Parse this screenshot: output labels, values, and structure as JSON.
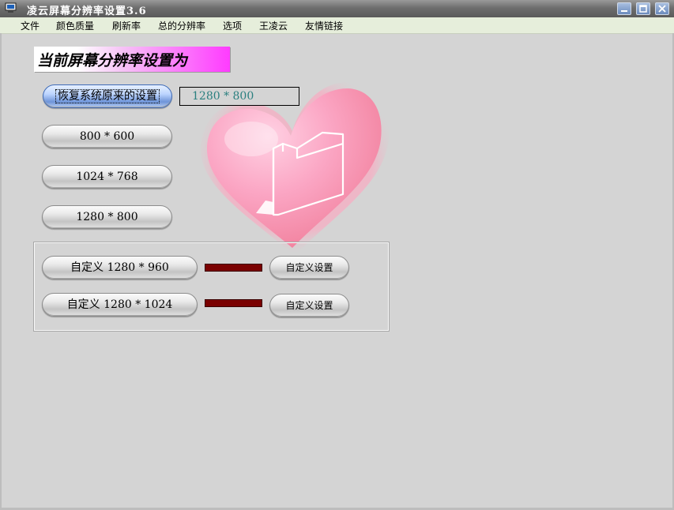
{
  "window": {
    "title": "凌云屏幕分辨率设置3.6"
  },
  "menu": [
    "文件",
    "颜色质量",
    "刷新率",
    "总的分辨率",
    "选项",
    "王凌云",
    "友情链接"
  ],
  "banner": "当前屏幕分辨率设置为",
  "current_resolution": "1280 * 800",
  "buttons": {
    "restore": "恢复系统原来的设置",
    "r800": "800 * 600",
    "r1024": "1024 * 768",
    "r1280": "1280 * 800",
    "custom1": "自定义 1280 * 960",
    "custom2": "自定义 1280 * 1024",
    "custom_set1": "自定义设置",
    "custom_set2": "自定义设置"
  },
  "colors": {
    "accent_bar": "#7a0000",
    "resolution_text": "#2a7f7f"
  },
  "icons": [
    "app-icon",
    "minimize-icon",
    "maximize-icon",
    "close-icon",
    "heart-folder-graphic"
  ]
}
